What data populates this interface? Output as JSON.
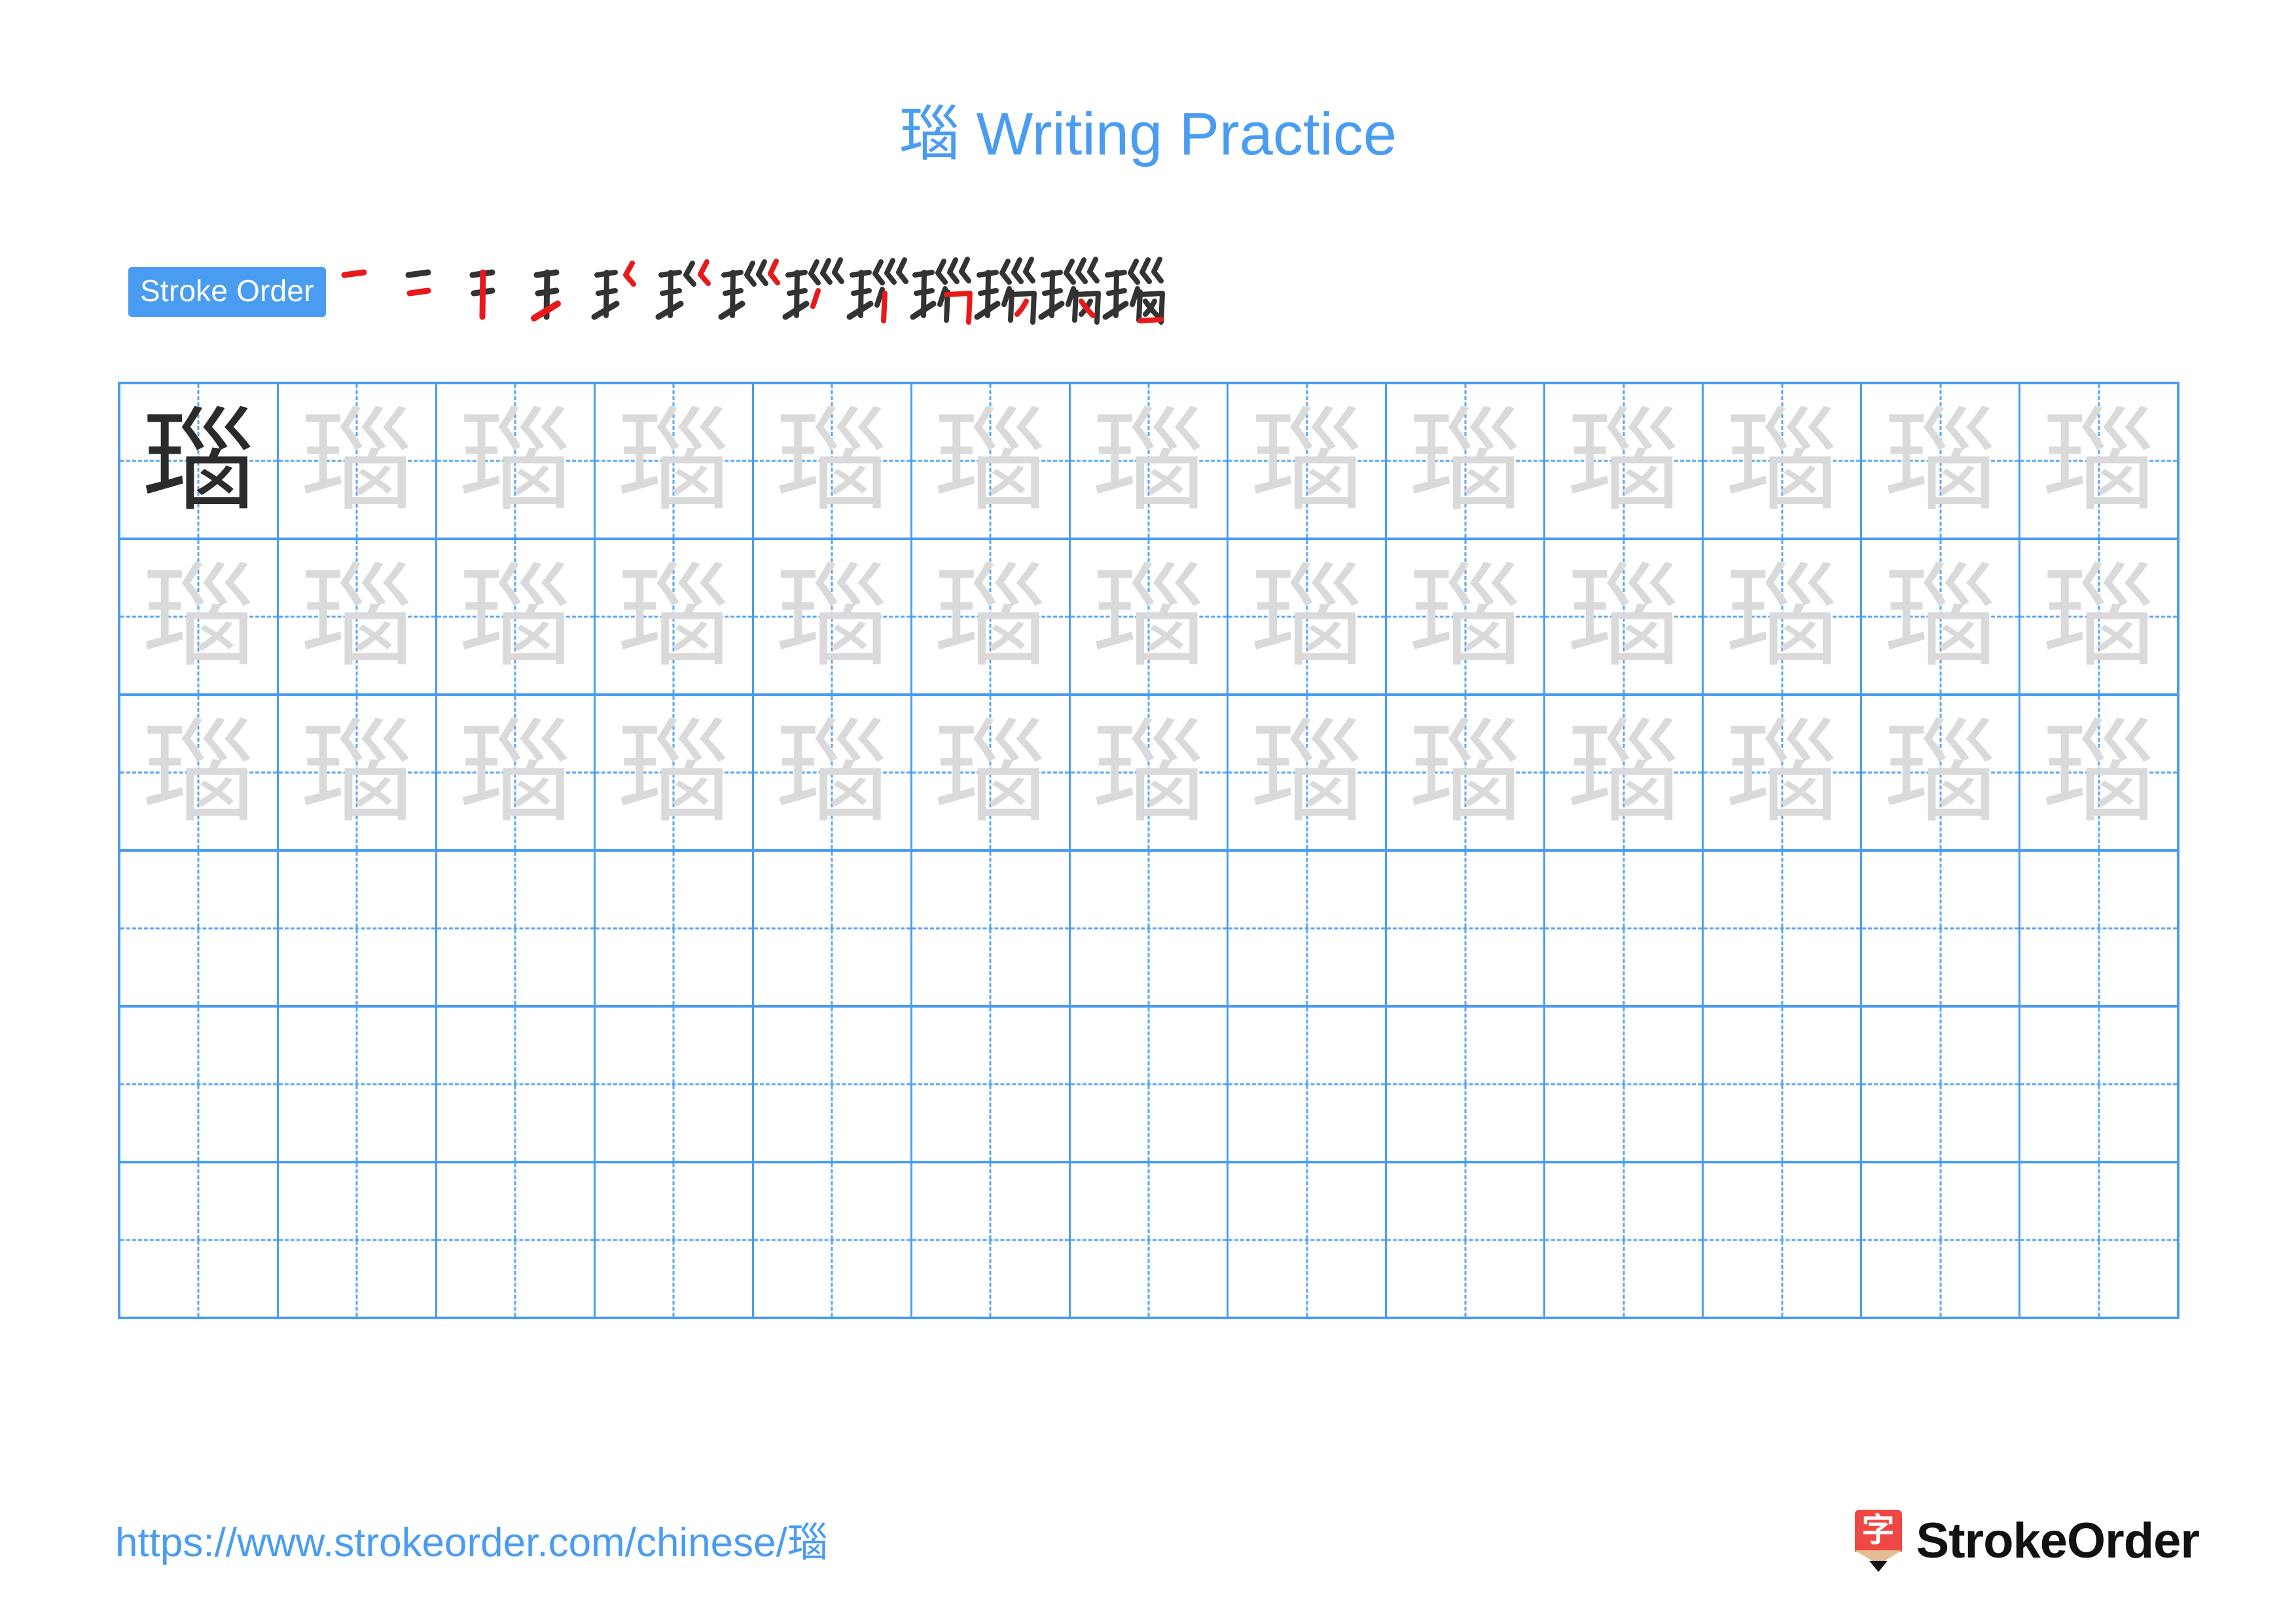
{
  "character": "瑙",
  "title": {
    "character": "瑙",
    "suffix": " Writing Practice",
    "full": "瑙 Writing Practice",
    "color": "#4a9cf0"
  },
  "stroke_order": {
    "label": "Stroke Order",
    "badge_bg": "#4a9cf0",
    "badge_text_color": "#ffffff",
    "total_strokes": 13,
    "new_stroke_color": "#e8191b",
    "existing_stroke_color": "#333333",
    "steps": [
      {
        "index": 1,
        "new_stroke": "heng (horizontal)",
        "strokes_shown": 1
      },
      {
        "index": 2,
        "new_stroke": "heng (horizontal)",
        "strokes_shown": 2
      },
      {
        "index": 3,
        "new_stroke": "shu (vertical)",
        "strokes_shown": 3
      },
      {
        "index": 4,
        "new_stroke": "ti (rising)",
        "strokes_shown": 4
      },
      {
        "index": 5,
        "new_stroke": "pie-zhe (bent left stroke)",
        "strokes_shown": 5
      },
      {
        "index": 6,
        "new_stroke": "pie-zhe (bent left stroke)",
        "strokes_shown": 6
      },
      {
        "index": 7,
        "new_stroke": "pie-zhe (bent left stroke)",
        "strokes_shown": 7
      },
      {
        "index": 8,
        "new_stroke": "pie (left falling)",
        "strokes_shown": 8
      },
      {
        "index": 9,
        "new_stroke": "shu (vertical)",
        "strokes_shown": 9
      },
      {
        "index": 10,
        "new_stroke": "heng-zhe (horizontal-turn)",
        "strokes_shown": 10
      },
      {
        "index": 11,
        "new_stroke": "pie (left falling)",
        "strokes_shown": 11
      },
      {
        "index": 12,
        "new_stroke": "na (right falling)",
        "strokes_shown": 12
      },
      {
        "index": 13,
        "new_stroke": "heng (horizontal closing)",
        "strokes_shown": 13
      }
    ]
  },
  "grid": {
    "rows": 6,
    "columns": 13,
    "border_color": "#4a9cf0",
    "guide_color": "#5aa7f2",
    "model_char_color": "#2b2b2b",
    "trace_char_color": "#dadada",
    "cells": [
      [
        "model",
        "trace",
        "trace",
        "trace",
        "trace",
        "trace",
        "trace",
        "trace",
        "trace",
        "trace",
        "trace",
        "trace",
        "trace"
      ],
      [
        "trace",
        "trace",
        "trace",
        "trace",
        "trace",
        "trace",
        "trace",
        "trace",
        "trace",
        "trace",
        "trace",
        "trace",
        "trace"
      ],
      [
        "trace",
        "trace",
        "trace",
        "trace",
        "trace",
        "trace",
        "trace",
        "trace",
        "trace",
        "trace",
        "trace",
        "trace",
        "trace"
      ],
      [
        "empty",
        "empty",
        "empty",
        "empty",
        "empty",
        "empty",
        "empty",
        "empty",
        "empty",
        "empty",
        "empty",
        "empty",
        "empty"
      ],
      [
        "empty",
        "empty",
        "empty",
        "empty",
        "empty",
        "empty",
        "empty",
        "empty",
        "empty",
        "empty",
        "empty",
        "empty",
        "empty"
      ],
      [
        "empty",
        "empty",
        "empty",
        "empty",
        "empty",
        "empty",
        "empty",
        "empty",
        "empty",
        "empty",
        "empty",
        "empty",
        "empty"
      ]
    ]
  },
  "footer": {
    "url_prefix": "https://www.strokeorder.com/chinese/",
    "url_character": "瑙",
    "url_full": "https://www.strokeorder.com/chinese/瑙",
    "url_color": "#4a9cf0",
    "brand_name": "StrokeOrder",
    "brand_glyph": "字",
    "brand_mark_color": "#ef4744",
    "brand_wood_color": "#e2bd96",
    "brand_tip_color": "#141414"
  }
}
